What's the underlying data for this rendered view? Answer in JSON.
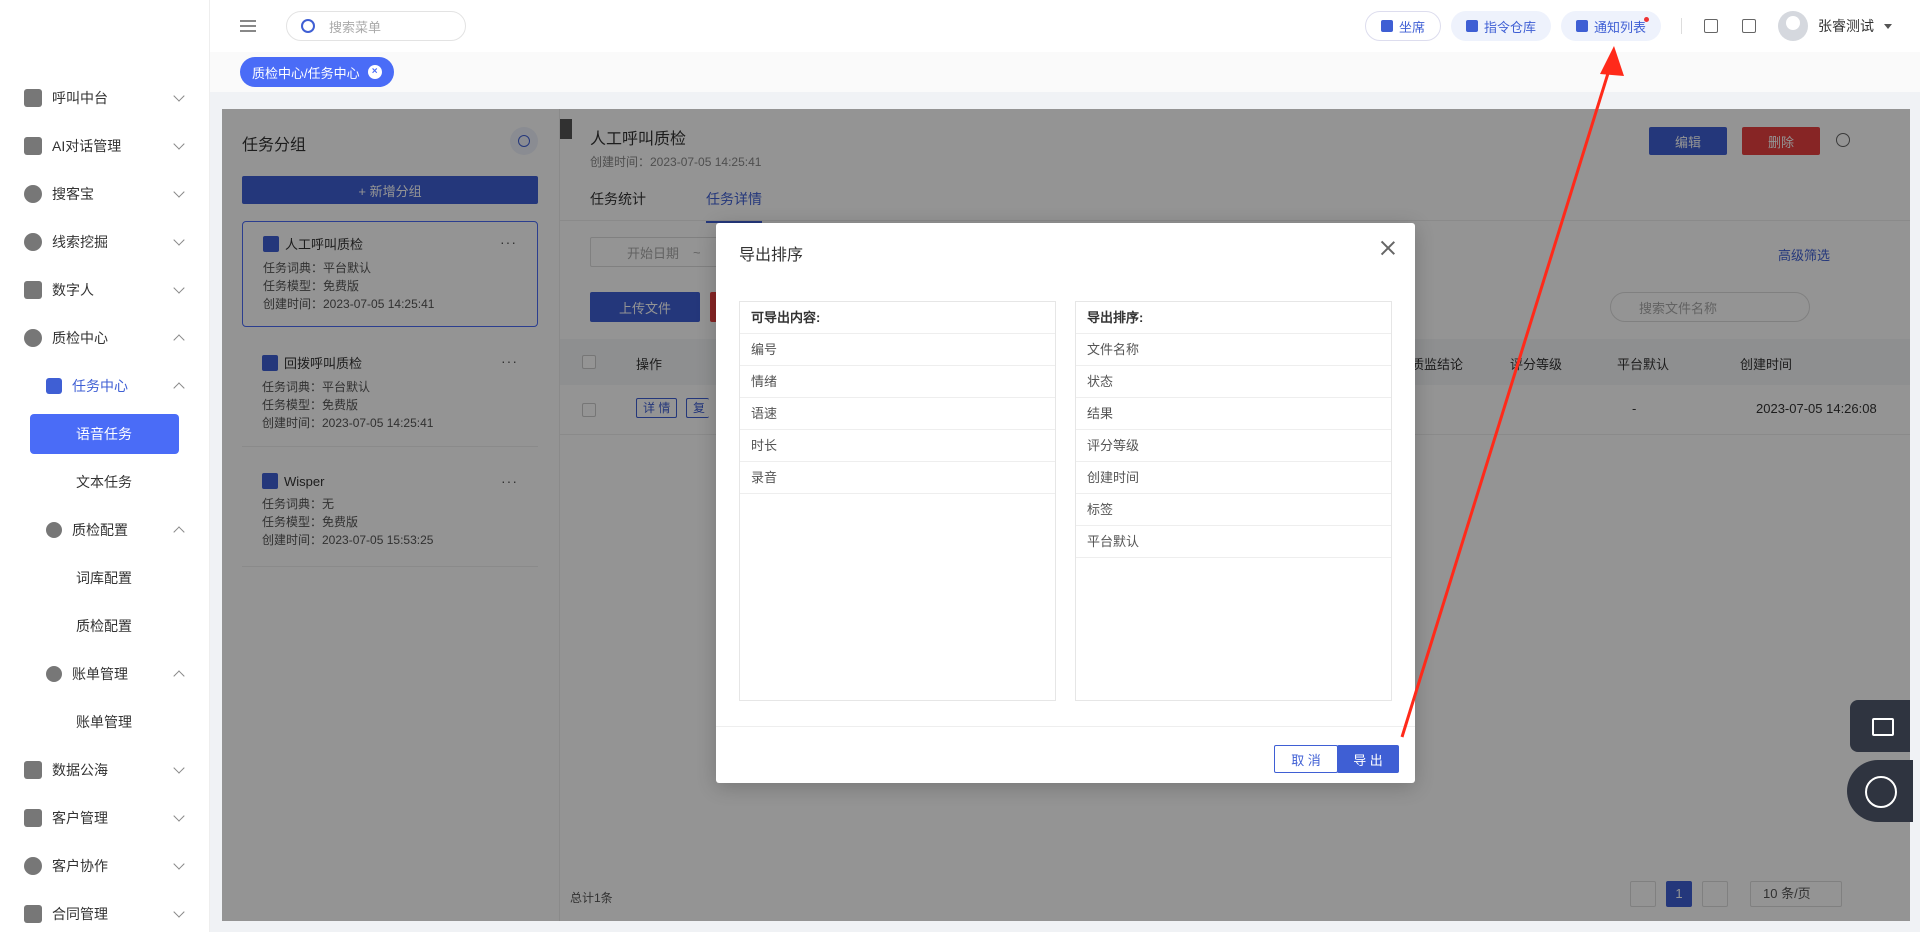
{
  "sidebar": {
    "items": [
      {
        "label": "呼叫中台",
        "icon": "monitor-icon"
      },
      {
        "label": "AI对话管理",
        "icon": "book-icon"
      },
      {
        "label": "搜客宝",
        "icon": "search-customer-icon"
      },
      {
        "label": "线索挖掘",
        "icon": "target-icon"
      },
      {
        "label": "数字人",
        "icon": "robot-icon"
      },
      {
        "label": "质检中心",
        "icon": "inspect-icon"
      },
      {
        "label": "任务中心",
        "icon": "task-icon"
      },
      {
        "label": "语音任务"
      },
      {
        "label": "文本任务"
      },
      {
        "label": "质检配置",
        "icon": "shield-icon"
      },
      {
        "label": "词库配置"
      },
      {
        "label": "质检配置"
      },
      {
        "label": "账单管理",
        "icon": "bill-icon"
      },
      {
        "label": "账单管理"
      },
      {
        "label": "数据公海",
        "icon": "chart-icon"
      },
      {
        "label": "客户管理",
        "icon": "customer-icon"
      },
      {
        "label": "客户协作",
        "icon": "collab-icon"
      },
      {
        "label": "合同管理",
        "icon": "clipboard-icon"
      }
    ]
  },
  "header": {
    "search_placeholder": "搜索菜单",
    "pills": [
      {
        "label": "坐席",
        "icon": "headset-icon"
      },
      {
        "label": "指令仓库",
        "icon": "command-icon"
      },
      {
        "label": "通知列表",
        "icon": "notice-icon"
      }
    ],
    "user_name": "张睿测试"
  },
  "tagbar": {
    "active_tag": "质检中心/任务中心"
  },
  "left_panel": {
    "title": "任务分组",
    "add_group": "+ 新增分组",
    "groups": [
      {
        "name": "人工呼叫质检",
        "dict": "任务词典：平台默认",
        "model": "任务模型：免费版",
        "created": "创建时间：2023-07-05 14:25:41"
      },
      {
        "name": "回拨呼叫质检",
        "dict": "任务词典：平台默认",
        "model": "任务模型：免费版",
        "created": "创建时间：2023-07-05 14:25:41"
      },
      {
        "name": "Wisper",
        "dict": "任务词典：无",
        "model": "任务模型：免费版",
        "created": "创建时间：2023-07-05 15:53:25"
      }
    ]
  },
  "right_panel": {
    "title": "人工呼叫质检",
    "subtitle": "创建时间：2023-07-05 14:25:41",
    "edit": "编辑",
    "delete": "删除",
    "tabs": [
      "任务统计",
      "任务详情"
    ],
    "date_placeholder": "开始日期",
    "date_sep": "~",
    "adv_filter": "高级筛选",
    "upload": "上传文件",
    "file_search_placeholder": "搜索文件名称",
    "columns": {
      "op": "操作",
      "conclusion": "质监结论",
      "grade": "评分等级",
      "platform": "平台默认",
      "created": "创建时间"
    },
    "row": {
      "detail": "详 情",
      "copy": "复",
      "platform": "-",
      "created": "2023-07-05 14:26:08"
    },
    "total": "总计1条",
    "page": "1",
    "page_size": "10 条/页"
  },
  "modal": {
    "title": "导出排序",
    "left_head": "可导出内容:",
    "left_items": [
      "编号",
      "情绪",
      "语速",
      "时长",
      "录音"
    ],
    "right_head": "导出排序:",
    "right_items": [
      "文件名称",
      "状态",
      "结果",
      "评分等级",
      "创建时间",
      "标签",
      "平台默认"
    ],
    "cancel": "取 消",
    "export": "导 出"
  },
  "colors": {
    "primary": "#3f5fd4",
    "danger": "#e84141",
    "arrow": "#ff2a1a"
  }
}
